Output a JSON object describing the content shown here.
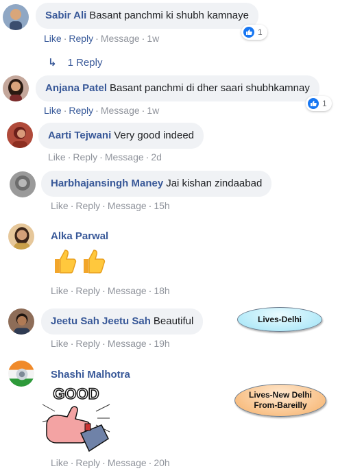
{
  "comments": [
    {
      "name": "Sabir Ali",
      "text": "Basant panchmi ki shubh kamnaye",
      "like": "Like",
      "reply": "Reply",
      "message": "Message",
      "time": "1w",
      "reactions": "1",
      "replies": "1 Reply"
    },
    {
      "name": "Anjana Patel",
      "text": "Basant panchmi di dher saari shubhkamnay",
      "like": "Like",
      "reply": "Reply",
      "message": "Message",
      "time": "1w",
      "reactions": "1"
    },
    {
      "name": "Aarti Tejwani",
      "text": "Very good indeed",
      "like": "Like",
      "reply": "Reply",
      "message": "Message",
      "time": "2d"
    },
    {
      "name": "Harbhajansingh Maney",
      "text": "Jai kishan zindaabad",
      "like": "Like",
      "reply": "Reply",
      "message": "Message",
      "time": "15h"
    },
    {
      "name": "Alka Parwal",
      "text": "",
      "like": "Like",
      "reply": "Reply",
      "message": "Message",
      "time": "18h"
    },
    {
      "name": "Jeetu Sah Jeetu Sah",
      "text": "Beautiful",
      "like": "Like",
      "reply": "Reply",
      "message": "Message",
      "time": "19h"
    },
    {
      "name": "Shashi Malhotra",
      "text": "",
      "like": "Like",
      "reply": "Reply",
      "message": "Message",
      "time": "20h",
      "sticker_text": "GOOD"
    }
  ],
  "annotations": {
    "delhi": "Lives-Delhi",
    "new_delhi_line1": "Lives-New Delhi",
    "new_delhi_line2": "From-Bareilly"
  },
  "colors": {
    "name": "#385898",
    "bubble": "#f0f2f5",
    "action": "#90949c",
    "like_blue": "#1877f2"
  },
  "icons": [
    "thumbs-up-emoji-icon",
    "reply-arrow-icon",
    "like-reaction-icon"
  ]
}
